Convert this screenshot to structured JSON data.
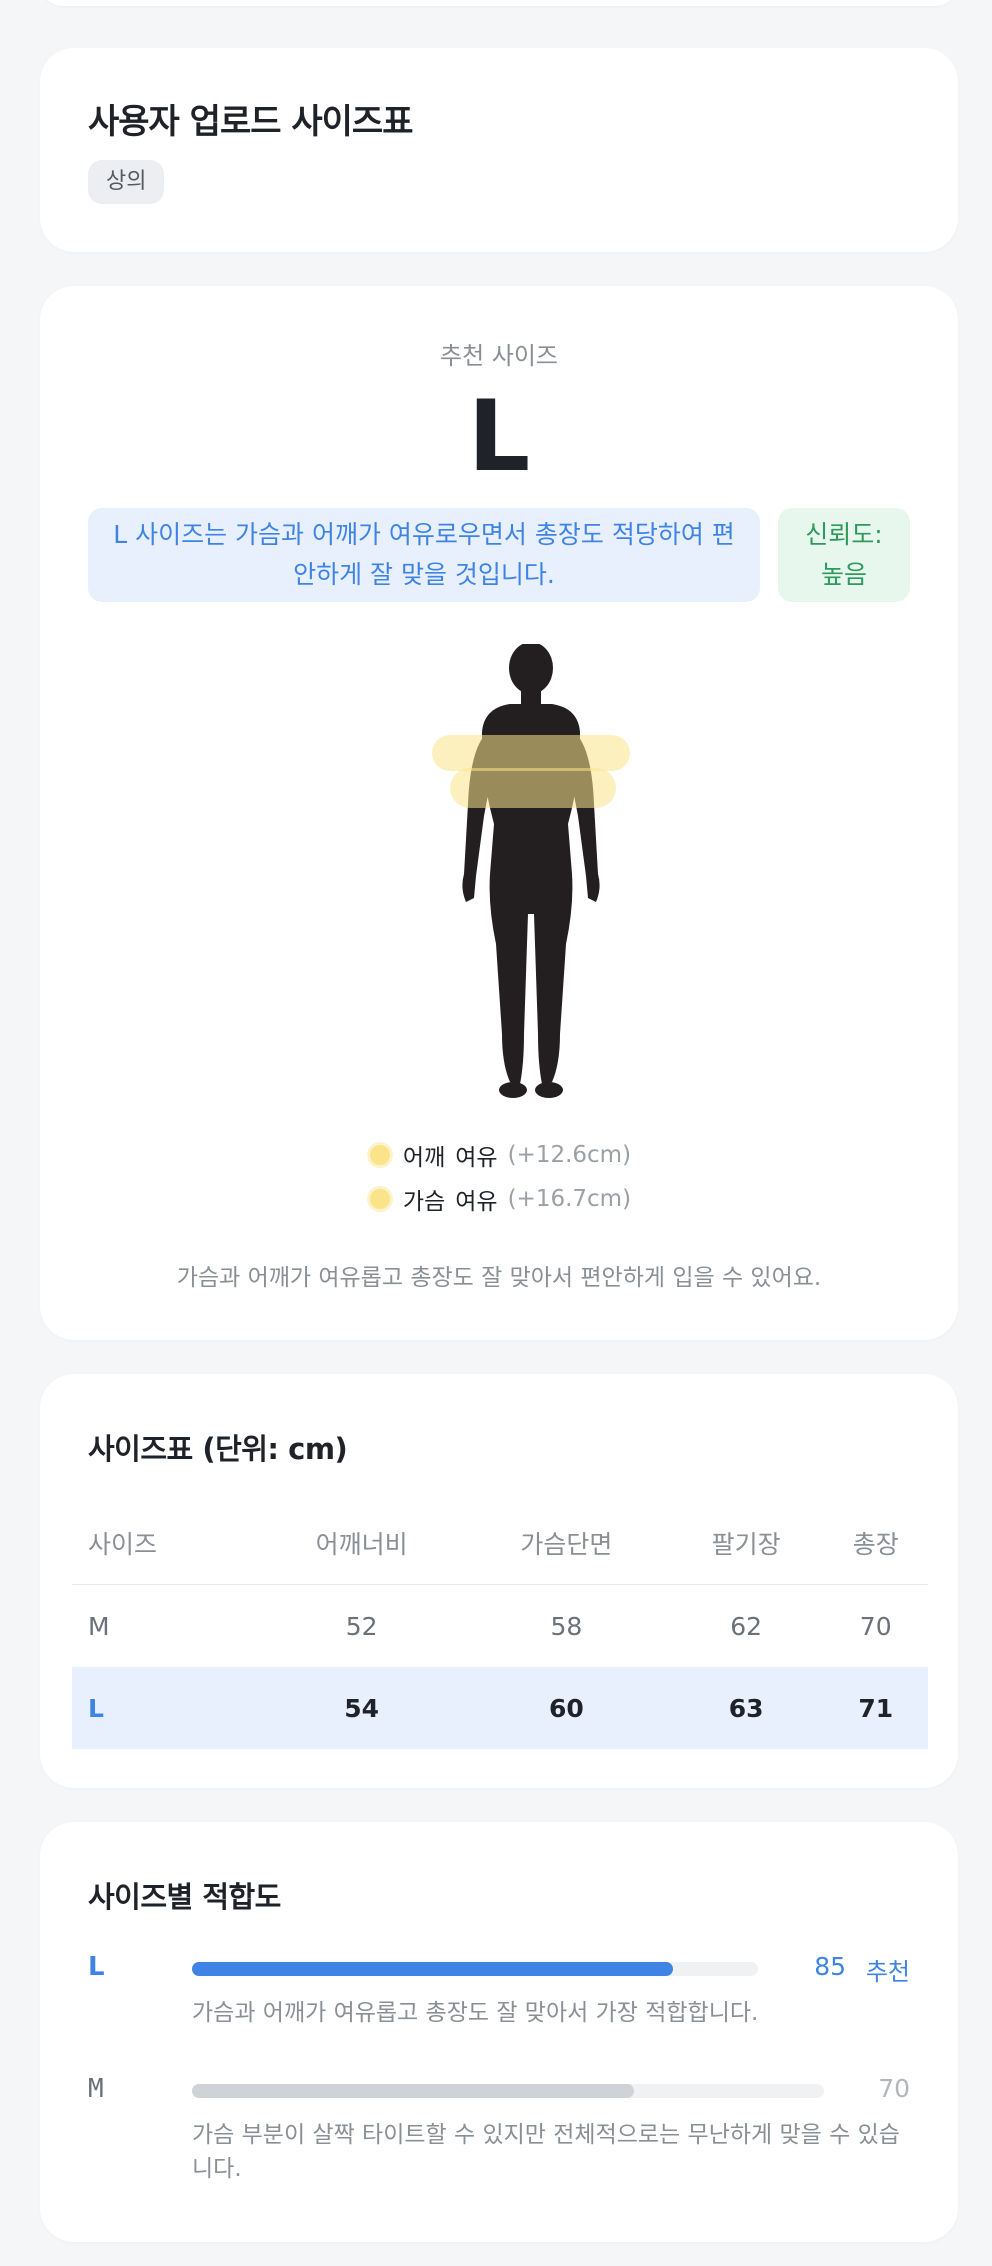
{
  "card1": {
    "title": "사용자 업로드 사이즈표",
    "category_tag": "상의"
  },
  "recommend": {
    "label": "추천 사이즈",
    "size": "L",
    "description": "L 사이즈는 가슴과 어깨가 여유로우면서 총장도 적당하여 편안하게 잘 맞을 것입니다.",
    "confidence_label": "신뢰도:",
    "confidence_value": "높음",
    "legend": [
      {
        "part": "어깨",
        "word": "여유",
        "value": "(+12.6cm)"
      },
      {
        "part": "가슴",
        "word": "여유",
        "value": "(+16.7cm)"
      }
    ],
    "note": "가슴과 어깨가 여유롭고 총장도 잘 맞아서 편안하게 입을 수 있어요.",
    "colors": {
      "highlight": "#fbe38a",
      "figure": "#231f20"
    }
  },
  "size_table": {
    "title": "사이즈표 (단위: cm)",
    "headers": [
      "사이즈",
      "어깨너비",
      "가슴단면",
      "팔기장",
      "총장"
    ],
    "rows": [
      [
        "M",
        "52",
        "58",
        "62",
        "70"
      ],
      [
        "L",
        "54",
        "60",
        "63",
        "71"
      ]
    ]
  },
  "fit": {
    "title": "사이즈별 적합도",
    "items": [
      {
        "size": "L",
        "score": 85,
        "score_text": "85",
        "badge": "추천",
        "description": "가슴과 어깨가 여유롭고 총장도 잘 맞아서 가장 적합합니다.",
        "color": "#3f84e5"
      },
      {
        "size": "M",
        "score": 70,
        "score_text": "70",
        "badge": "",
        "description": "가슴 부분이 살짝 타이트할 수 있지만 전체적으로는 무난하게 맞을 수 있습니다.",
        "color": "#cfd2d6"
      }
    ]
  }
}
